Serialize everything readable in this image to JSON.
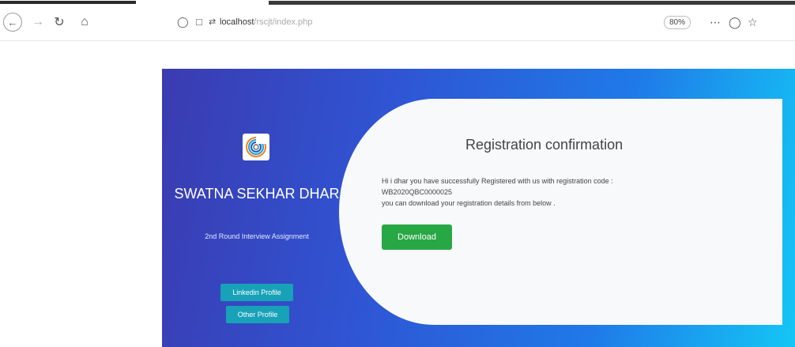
{
  "browser": {
    "url_host": "localhost",
    "url_path": "/rscjt/index.php",
    "zoom": "80%",
    "icons": {
      "back": "back-arrow-icon",
      "forward": "forward-arrow-icon",
      "reload": "reload-icon",
      "home": "home-icon",
      "shield": "shield-icon",
      "page": "page-icon",
      "permissions": "permissions-icon",
      "more": "more-actions-icon",
      "pocket": "pocket-icon",
      "bookmark": "star-icon"
    }
  },
  "profile": {
    "name": "SWATNA SEKHAR DHAR",
    "subtitle": "2nd Round Interview Assignment",
    "linkedin_label": "Linkedin Profile",
    "other_label": "Other Profile"
  },
  "confirmation": {
    "title": "Registration confirmation",
    "line1": "Hi i dhar you have successfully Registered with us with registration code :",
    "code": "WB2020QBC0000025",
    "line3": "you can download your registration details from below .",
    "download_label": "Download"
  },
  "colors": {
    "gradient_start": "#3b3bb0",
    "gradient_end": "#14c6f5",
    "card_bg": "#f8f9fa",
    "download_button": "#28a745",
    "profile_button": "#17a2b8"
  }
}
